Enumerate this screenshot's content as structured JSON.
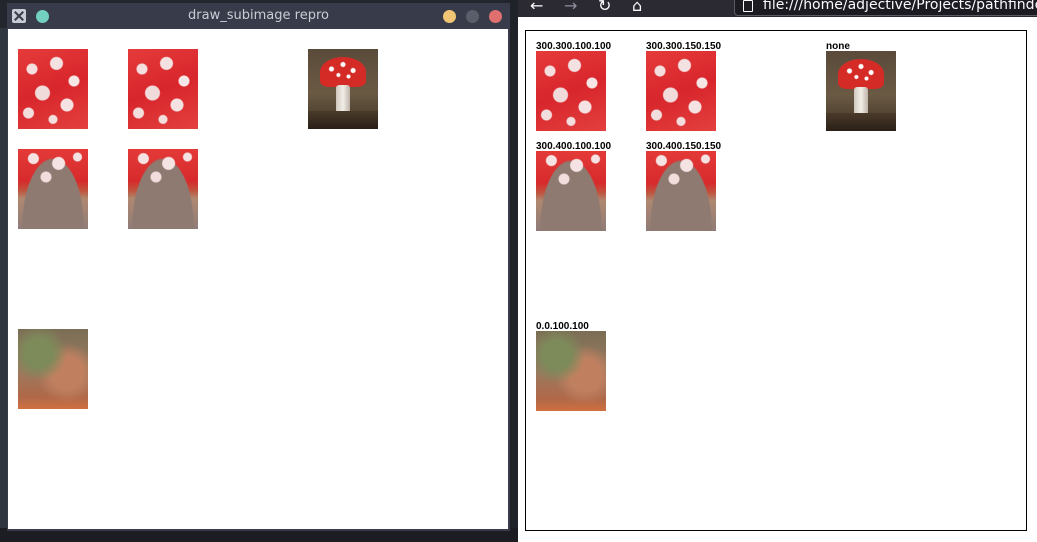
{
  "xwindow": {
    "title": "draw_subimage repro"
  },
  "browser": {
    "url": "file:///home/adjective/Projects/pathfinder_",
    "labels": {
      "r1c1": "300.300.100.100",
      "r1c2": "300.300.150.150",
      "r1c3": "none",
      "r2c1": "300.400.100.100",
      "r2c2": "300.400.150.150",
      "r3c1": "0.0.100.100"
    }
  },
  "icons": {
    "x_logo": "x-logo-icon",
    "back": "back-arrow-icon",
    "forward": "forward-arrow-icon",
    "reload": "reload-icon",
    "home": "home-icon",
    "page": "page-icon"
  }
}
